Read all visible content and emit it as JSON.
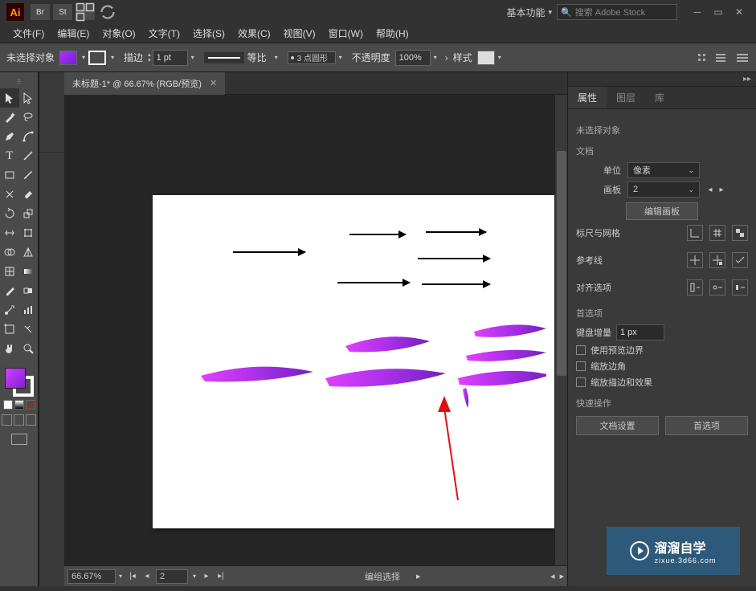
{
  "topbar": {
    "app": "Ai",
    "bridge": "Br",
    "stock": "St",
    "workspace_label": "基本功能",
    "search_placeholder": "搜索 Adobe Stock"
  },
  "menu": {
    "file": "文件(F)",
    "edit": "编辑(E)",
    "object": "对象(O)",
    "type": "文字(T)",
    "select": "选择(S)",
    "effect": "效果(C)",
    "view": "视图(V)",
    "window": "窗口(W)",
    "help": "帮助(H)"
  },
  "control": {
    "no_sel": "未选择对象",
    "stroke_label": "描边",
    "stroke_weight": "1 pt",
    "uniform": "等比",
    "profile": "3 点圆形",
    "opacity_label": "不透明度",
    "opacity_value": "100%",
    "style_label": "样式"
  },
  "tab": {
    "title": "未标题-1* @ 66.67% (RGB/预览)"
  },
  "statusbar": {
    "zoom": "66.67%",
    "artboard": "2",
    "selection_label": "编组选择"
  },
  "props": {
    "tabs": {
      "properties": "属性",
      "layers": "图层",
      "libraries": "库"
    },
    "no_sel": "未选择对象",
    "doc_section": "文档",
    "units_label": "单位",
    "units_value": "像素",
    "artboard_label": "画板",
    "artboard_value": "2",
    "edit_artboard": "编辑画板",
    "rulers_grid": "标尺与网格",
    "guides": "参考线",
    "align_options": "对齐选项",
    "prefs_section": "首选项",
    "key_inc_label": "键盘增量",
    "key_inc_value": "1 px",
    "use_preview": "使用预览边界",
    "scale_corners": "缩放边角",
    "scale_strokes": "缩放描边和效果",
    "quick_actions": "快速操作",
    "doc_setup": "文档设置",
    "prefs_btn": "首选项"
  },
  "watermark": {
    "title": "溜溜自学",
    "sub": "zixue.3d66.com"
  }
}
